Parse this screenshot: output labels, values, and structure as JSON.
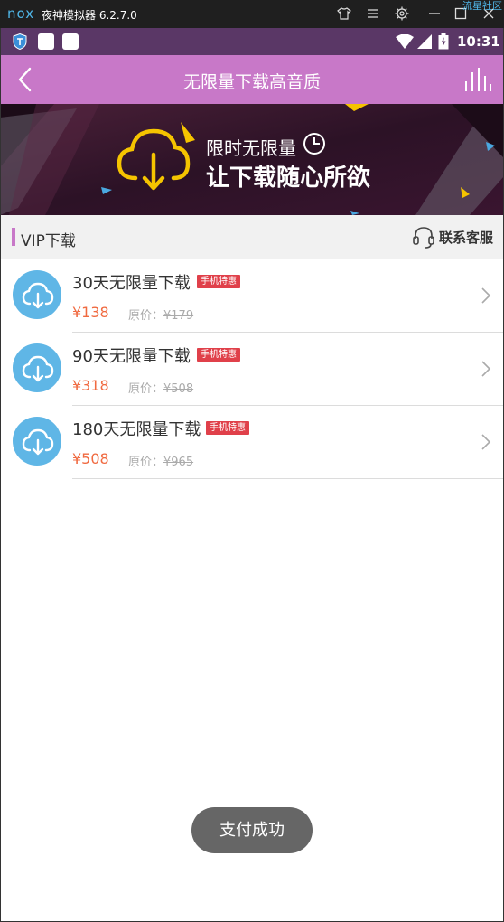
{
  "emulator": {
    "title": "夜神模拟器 6.2.7.0",
    "logo": "nox",
    "corner_text": "流星社区"
  },
  "status_bar": {
    "time": "10:31"
  },
  "header": {
    "title": "无限量下载高音质"
  },
  "banner": {
    "line1": "限时无限量",
    "line2": "让下载随心所欲"
  },
  "section": {
    "title": "VIP下载",
    "service_label": "联系客服"
  },
  "products": [
    {
      "name": "30天无限量下载",
      "badge": "手机特惠",
      "price": "¥138",
      "orig_label": "原价：",
      "orig_price": "¥179"
    },
    {
      "name": "90天无限量下载",
      "badge": "手机特惠",
      "price": "¥318",
      "orig_label": "原价：",
      "orig_price": "¥508"
    },
    {
      "name": "180天无限量下载",
      "badge": "手机特惠",
      "price": "¥508",
      "orig_label": "原价：",
      "orig_price": "¥965"
    }
  ],
  "toast": {
    "text": "支付成功"
  },
  "colors": {
    "header": "#c878c8",
    "status_bar": "#5a3766",
    "price": "#f06a40",
    "badge": "#e0404a",
    "icon_circle": "#5fb6e6"
  }
}
